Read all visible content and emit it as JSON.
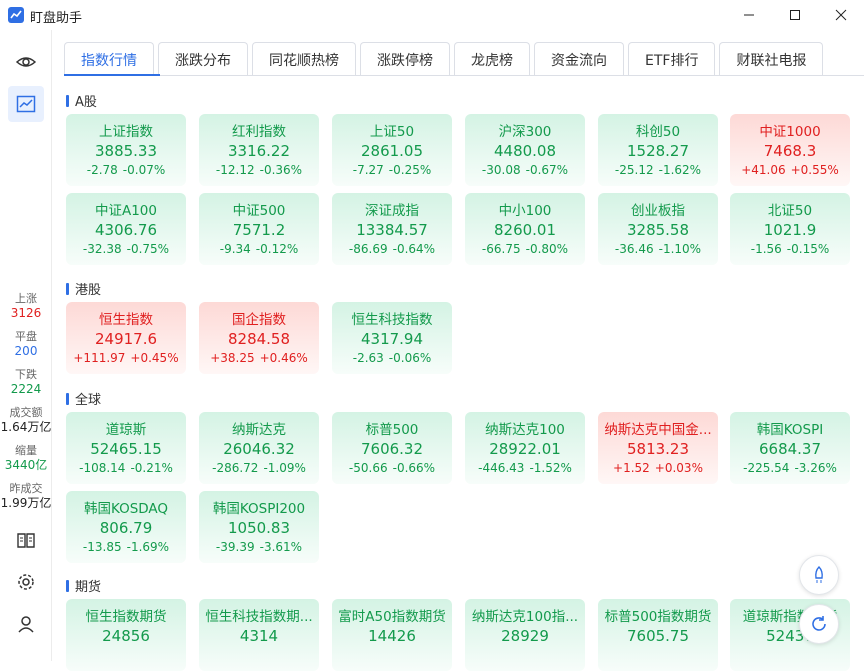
{
  "app": {
    "title": "盯盘助手"
  },
  "tabs": [
    "指数行情",
    "涨跌分布",
    "同花顺热榜",
    "涨跌停榜",
    "龙虎榜",
    "资金流向",
    "ETF排行",
    "财联社电报"
  ],
  "stats": [
    {
      "label": "上涨",
      "value": "3126",
      "color": "#e02020"
    },
    {
      "label": "平盘",
      "value": "200",
      "color": "#2f6fe4"
    },
    {
      "label": "下跌",
      "value": "2224",
      "color": "#139a4c"
    },
    {
      "label": "成交额",
      "value": "1.64万亿",
      "color": "#222"
    },
    {
      "label": "缩量",
      "value": "3440亿",
      "color": "#139a4c"
    },
    {
      "label": "昨成交",
      "value": "1.99万亿",
      "color": "#222"
    }
  ],
  "sections": [
    {
      "title": "A股",
      "cards": [
        {
          "name": "上证指数",
          "price": "3885.33",
          "change": "-2.78",
          "pct": "-0.07%",
          "trend": "down"
        },
        {
          "name": "红利指数",
          "price": "3316.22",
          "change": "-12.12",
          "pct": "-0.36%",
          "trend": "down"
        },
        {
          "name": "上证50",
          "price": "2861.05",
          "change": "-7.27",
          "pct": "-0.25%",
          "trend": "down"
        },
        {
          "name": "沪深300",
          "price": "4480.08",
          "change": "-30.08",
          "pct": "-0.67%",
          "trend": "down"
        },
        {
          "name": "科创50",
          "price": "1528.27",
          "change": "-25.12",
          "pct": "-1.62%",
          "trend": "down"
        },
        {
          "name": "中证1000",
          "price": "7468.3",
          "change": "+41.06",
          "pct": "+0.55%",
          "trend": "up"
        },
        {
          "name": "中证A100",
          "price": "4306.76",
          "change": "-32.38",
          "pct": "-0.75%",
          "trend": "down"
        },
        {
          "name": "中证500",
          "price": "7571.2",
          "change": "-9.34",
          "pct": "-0.12%",
          "trend": "down"
        },
        {
          "name": "深证成指",
          "price": "13384.57",
          "change": "-86.69",
          "pct": "-0.64%",
          "trend": "down"
        },
        {
          "name": "中小100",
          "price": "8260.01",
          "change": "-66.75",
          "pct": "-0.80%",
          "trend": "down"
        },
        {
          "name": "创业板指",
          "price": "3285.58",
          "change": "-36.46",
          "pct": "-1.10%",
          "trend": "down"
        },
        {
          "name": "北证50",
          "price": "1021.9",
          "change": "-1.56",
          "pct": "-0.15%",
          "trend": "down"
        }
      ]
    },
    {
      "title": "港股",
      "cards": [
        {
          "name": "恒生指数",
          "price": "24917.6",
          "change": "+111.97",
          "pct": "+0.45%",
          "trend": "up"
        },
        {
          "name": "国企指数",
          "price": "8284.58",
          "change": "+38.25",
          "pct": "+0.46%",
          "trend": "up"
        },
        {
          "name": "恒生科技指数",
          "price": "4317.94",
          "change": "-2.63",
          "pct": "-0.06%",
          "trend": "down"
        }
      ]
    },
    {
      "title": "全球",
      "cards": [
        {
          "name": "道琼斯",
          "price": "52465.15",
          "change": "-108.14",
          "pct": "-0.21%",
          "trend": "down"
        },
        {
          "name": "纳斯达克",
          "price": "26046.32",
          "change": "-286.72",
          "pct": "-1.09%",
          "trend": "down"
        },
        {
          "name": "标普500",
          "price": "7606.32",
          "change": "-50.66",
          "pct": "-0.66%",
          "trend": "down"
        },
        {
          "name": "纳斯达克100",
          "price": "28922.01",
          "change": "-446.43",
          "pct": "-1.52%",
          "trend": "down"
        },
        {
          "name": "纳斯达克中国金...",
          "price": "5813.23",
          "change": "+1.52",
          "pct": "+0.03%",
          "trend": "up"
        },
        {
          "name": "韩国KOSPI",
          "price": "6684.37",
          "change": "-225.54",
          "pct": "-3.26%",
          "trend": "down"
        },
        {
          "name": "韩国KOSDAQ",
          "price": "806.79",
          "change": "-13.85",
          "pct": "-1.69%",
          "trend": "down"
        },
        {
          "name": "韩国KOSPI200",
          "price": "1050.83",
          "change": "-39.39",
          "pct": "-3.61%",
          "trend": "down"
        }
      ]
    },
    {
      "title": "期货",
      "cards": [
        {
          "name": "恒生指数期货",
          "price": "24856",
          "change": "",
          "pct": "",
          "trend": "down"
        },
        {
          "name": "恒生科技指数期...",
          "price": "4314",
          "change": "",
          "pct": "",
          "trend": "down"
        },
        {
          "name": "富时A50指数期货",
          "price": "14426",
          "change": "",
          "pct": "",
          "trend": "down"
        },
        {
          "name": "纳斯达克100指...",
          "price": "28929",
          "change": "",
          "pct": "",
          "trend": "down"
        },
        {
          "name": "标普500指数期货",
          "price": "7605.75",
          "change": "",
          "pct": "",
          "trend": "down"
        },
        {
          "name": "道琼斯指数期货",
          "price": "52437",
          "change": "",
          "pct": "",
          "trend": "down"
        }
      ]
    }
  ],
  "colors": {
    "up": "#e02020",
    "down": "#139a4c",
    "accent": "#2f6fe4"
  }
}
